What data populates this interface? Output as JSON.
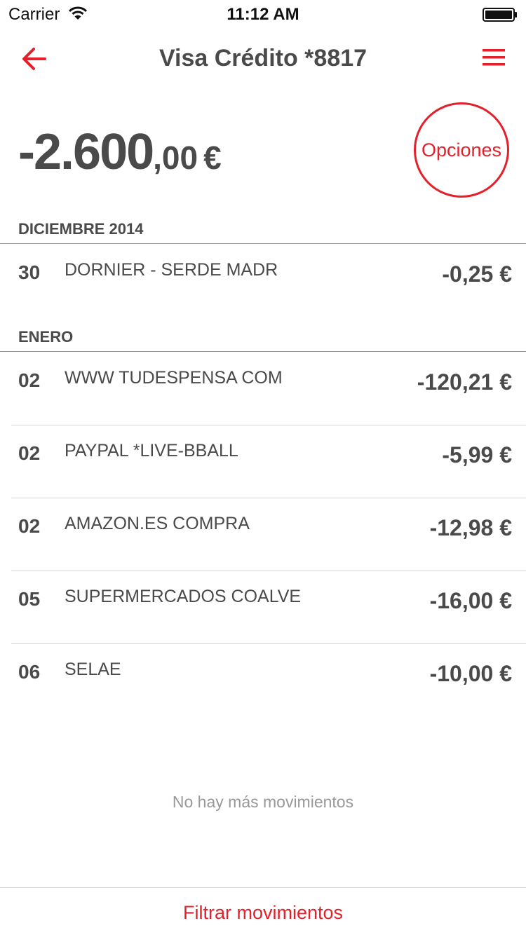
{
  "status_bar": {
    "carrier": "Carrier",
    "time": "11:12 AM",
    "icons": [
      "wifi-icon",
      "battery-icon"
    ]
  },
  "nav": {
    "title": "Visa Crédito *8817",
    "back_icon": "arrow-left-icon",
    "menu_icon": "hamburger-menu-icon",
    "accent_color": "#e4202b"
  },
  "balance": {
    "integer": "-2.600",
    "decimals": ",00",
    "currency": "€"
  },
  "options_button": {
    "label": "Opciones"
  },
  "sections": [
    {
      "title": "DICIEMBRE 2014",
      "movements": [
        {
          "day": "30",
          "description": "DORNIER - SERDE MADR",
          "amount": "-0,25 €"
        }
      ]
    },
    {
      "title": "ENERO",
      "movements": [
        {
          "day": "02",
          "description": "WWW TUDESPENSA COM",
          "amount": "-120,21 €"
        },
        {
          "day": "02",
          "description": "PAYPAL *LIVE-BBALL",
          "amount": "-5,99 €"
        },
        {
          "day": "02",
          "description": "AMAZON.ES COMPRA",
          "amount": "-12,98 €"
        },
        {
          "day": "05",
          "description": "SUPERMERCADOS COALVE",
          "amount": "-16,00 €"
        },
        {
          "day": "06",
          "description": "SELAE",
          "amount": "-10,00 €"
        }
      ]
    }
  ],
  "footer_note": "No hay más movimientos",
  "filter_button": {
    "label": "Filtrar movimientos"
  }
}
